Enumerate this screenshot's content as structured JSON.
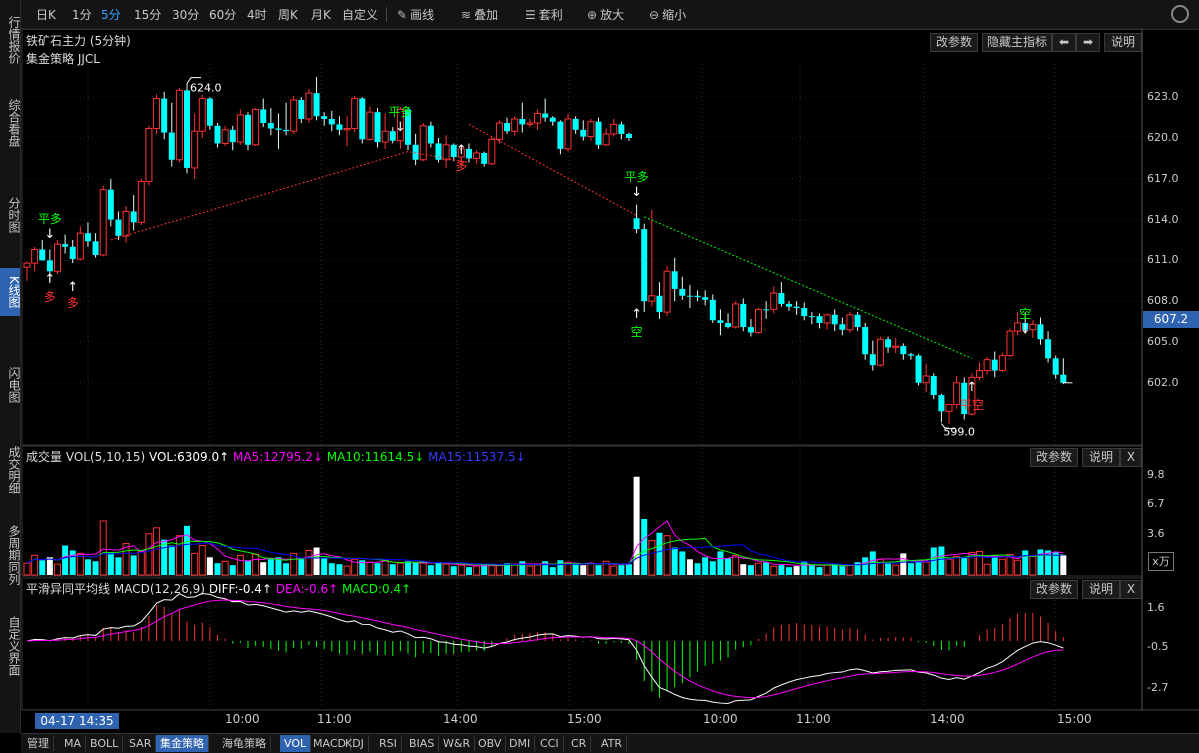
{
  "sidebar": {
    "items": [
      {
        "label": "行情报价",
        "active": false
      },
      {
        "label": "综合看盘",
        "active": false
      },
      {
        "label": "分时图",
        "active": false
      },
      {
        "label": "K线图",
        "active": true
      },
      {
        "label": "闪电图",
        "active": false
      },
      {
        "label": "成交明细",
        "active": false
      },
      {
        "label": "多周期同列",
        "active": false
      },
      {
        "label": "自定义界面",
        "active": false
      }
    ]
  },
  "toolbar": {
    "periods": [
      "日K",
      "1分",
      "5分",
      "15分",
      "30分",
      "60分",
      "4时",
      "周K",
      "月K",
      "自定义"
    ],
    "active_period": "5分",
    "tools": [
      {
        "label": "画线",
        "icon": "pencil-icon"
      },
      {
        "label": "叠加",
        "icon": "stack-icon"
      },
      {
        "label": "套利",
        "icon": "arbitrage-icon"
      },
      {
        "label": "放大",
        "icon": "zoom-in-icon"
      },
      {
        "label": "缩小",
        "icon": "zoom-out-icon"
      }
    ]
  },
  "main_panel": {
    "title": "铁矿石主力 (5分钟)",
    "strategy": "集金策略 JJCL",
    "buttons": {
      "params": "改参数",
      "hide": "隐藏主指标",
      "help": "说明"
    },
    "current_price": "607.2",
    "high_label": "624.0",
    "low_label": "599.0",
    "price_ticks": [
      "623.0",
      "620.0",
      "617.0",
      "614.0",
      "611.0",
      "608.0",
      "605.0",
      "602.0"
    ],
    "signals": [
      "平多",
      "多",
      "多",
      "平多",
      "多",
      "平多",
      "空",
      "空",
      "平空"
    ]
  },
  "volume_panel": {
    "name": "成交量",
    "formula": "VOL(5,10,15)",
    "vol": "VOL:6309.0↑",
    "ma5": "MA5:12795.2↓",
    "ma10": "MA10:11614.5↓",
    "ma15": "MA15:11537.5↓",
    "ticks": [
      "9.8",
      "6.7",
      "3.6"
    ],
    "unit": "x万",
    "buttons": {
      "params": "改参数",
      "help": "说明",
      "close": "X"
    }
  },
  "macd_panel": {
    "name": "平滑异同平均线",
    "formula": "MACD(12,26,9)",
    "diff": "DIFF:-0.4↑",
    "dea": "DEA:-0.6↑",
    "macd": "MACD:0.4↑",
    "ticks": [
      "1.6",
      "-0.5",
      "-2.7"
    ],
    "buttons": {
      "params": "改参数",
      "help": "说明",
      "close": "X"
    }
  },
  "x_axis": {
    "cursor_label": "04-17 14:35",
    "labels": [
      "10:00",
      "11:00",
      "14:00",
      "15:00",
      "10:00",
      "11:00",
      "14:00",
      "15:00"
    ]
  },
  "bottom_tabs": [
    "管理",
    "MA",
    "BOLL",
    "SAR",
    "集金策略",
    "海龟策略",
    "VOL",
    "MACD",
    "KDJ",
    "RSI",
    "BIAS",
    "W&R",
    "OBV",
    "DMI",
    "CCI",
    "CR",
    "ATR"
  ],
  "bottom_active": [
    "集金策略",
    "VOL"
  ],
  "colors": {
    "up": "#ff3232",
    "down": "#00ffff",
    "ma5": "#ff00ff",
    "ma10": "#00ff00",
    "ma15": "#0000ff",
    "diff": "#ffffff",
    "dea": "#ff00ff",
    "accent": "#2f63b0"
  },
  "chart_data": {
    "type": "candlestick",
    "price_range": [
      597.5,
      625.0
    ],
    "candles": [
      [
        610.5,
        610.9,
        609.5,
        610.8
      ],
      [
        610.8,
        612.0,
        610.2,
        611.8
      ],
      [
        611.8,
        612.5,
        611.0,
        611.0
      ],
      [
        611.0,
        611.8,
        609.5,
        610.2
      ],
      [
        610.2,
        612.5,
        610.0,
        612.2
      ],
      [
        612.2,
        612.9,
        611.5,
        612.0
      ],
      [
        612.0,
        612.5,
        610.8,
        611.1
      ],
      [
        611.1,
        613.5,
        611.0,
        613.0
      ],
      [
        613.0,
        613.8,
        612.0,
        612.4
      ],
      [
        612.4,
        613.0,
        611.2,
        611.4
      ],
      [
        611.4,
        616.5,
        611.3,
        616.2
      ],
      [
        616.2,
        617.0,
        613.5,
        614.0
      ],
      [
        614.0,
        614.6,
        612.5,
        612.8
      ],
      [
        612.8,
        615.0,
        612.3,
        614.6
      ],
      [
        614.6,
        615.8,
        613.2,
        613.8
      ],
      [
        613.8,
        617.0,
        613.6,
        616.8
      ],
      [
        616.8,
        620.9,
        616.5,
        620.7
      ],
      [
        620.7,
        623.2,
        620.3,
        622.9
      ],
      [
        622.9,
        623.4,
        619.9,
        620.4
      ],
      [
        620.4,
        622.6,
        617.9,
        618.4
      ],
      [
        618.4,
        623.7,
        618.2,
        623.5
      ],
      [
        623.5,
        624.0,
        617.4,
        617.8
      ],
      [
        617.8,
        621.8,
        617.0,
        620.5
      ],
      [
        620.5,
        623.2,
        620.0,
        622.9
      ],
      [
        622.9,
        623.0,
        620.6,
        620.9
      ],
      [
        620.9,
        621.1,
        619.3,
        619.6
      ],
      [
        619.6,
        620.9,
        619.4,
        620.6
      ],
      [
        620.6,
        620.9,
        619.1,
        619.7
      ],
      [
        619.7,
        622.1,
        619.5,
        621.7
      ],
      [
        621.7,
        621.9,
        619.1,
        619.5
      ],
      [
        619.5,
        622.2,
        619.4,
        622.1
      ],
      [
        622.1,
        622.9,
        620.8,
        621.1
      ],
      [
        621.1,
        622.2,
        620.2,
        620.7
      ],
      [
        620.7,
        621.8,
        619.2,
        620.6
      ],
      [
        620.6,
        622.6,
        620.2,
        620.5
      ],
      [
        620.5,
        623.1,
        620.3,
        622.8
      ],
      [
        622.8,
        623.0,
        621.1,
        621.4
      ],
      [
        621.4,
        623.6,
        621.1,
        623.3
      ],
      [
        623.3,
        624.5,
        621.3,
        621.6
      ],
      [
        621.6,
        621.9,
        620.9,
        621.4
      ],
      [
        621.4,
        622.0,
        620.5,
        621.0
      ],
      [
        621.0,
        621.6,
        620.2,
        620.6
      ],
      [
        620.6,
        621.6,
        619.4,
        620.7
      ],
      [
        620.7,
        623.1,
        620.4,
        622.9
      ],
      [
        622.9,
        623.0,
        619.6,
        619.9
      ],
      [
        619.9,
        622.3,
        619.8,
        621.9
      ],
      [
        621.9,
        622.2,
        619.3,
        619.7
      ],
      [
        619.7,
        621.8,
        619.2,
        620.5
      ],
      [
        620.5,
        620.8,
        619.6,
        619.8
      ],
      [
        619.8,
        622.3,
        619.2,
        622.1
      ],
      [
        622.1,
        622.2,
        619.1,
        619.5
      ],
      [
        619.5,
        620.3,
        618.0,
        618.4
      ],
      [
        618.4,
        621.1,
        618.3,
        620.9
      ],
      [
        620.9,
        621.2,
        619.3,
        619.6
      ],
      [
        619.6,
        620.0,
        618.2,
        618.4
      ],
      [
        618.4,
        620.2,
        617.8,
        619.5
      ],
      [
        619.5,
        619.6,
        618.3,
        618.6
      ],
      [
        618.6,
        619.5,
        618.0,
        619.2
      ],
      [
        619.2,
        619.6,
        618.2,
        618.5
      ],
      [
        618.5,
        619.1,
        618.1,
        618.9
      ],
      [
        618.9,
        619.0,
        617.9,
        618.1
      ],
      [
        618.1,
        620.1,
        618.0,
        619.9
      ],
      [
        619.9,
        621.3,
        619.6,
        621.1
      ],
      [
        621.1,
        621.5,
        620.3,
        620.5
      ],
      [
        620.5,
        621.6,
        620.2,
        621.4
      ],
      [
        621.4,
        622.6,
        620.4,
        621.0
      ],
      [
        621.0,
        621.4,
        620.8,
        621.1
      ],
      [
        621.1,
        622.1,
        620.6,
        621.8
      ],
      [
        621.8,
        622.9,
        621.2,
        621.5
      ],
      [
        621.5,
        621.6,
        620.9,
        621.2
      ],
      [
        621.2,
        621.3,
        618.8,
        619.2
      ],
      [
        619.2,
        621.8,
        619.0,
        621.4
      ],
      [
        621.4,
        621.6,
        620.3,
        620.6
      ],
      [
        620.6,
        621.3,
        619.8,
        620.1
      ],
      [
        620.1,
        621.4,
        619.8,
        621.2
      ],
      [
        621.2,
        621.5,
        619.2,
        619.5
      ],
      [
        619.5,
        620.7,
        619.4,
        620.3
      ],
      [
        620.3,
        621.4,
        620.1,
        621.0
      ],
      [
        621.0,
        621.2,
        619.9,
        620.3
      ],
      [
        620.3,
        620.4,
        619.8,
        620.0
      ],
      [
        614.1,
        615.1,
        613.0,
        613.3
      ],
      [
        613.3,
        613.7,
        607.2,
        608.0
      ],
      [
        608.0,
        614.7,
        607.6,
        608.4
      ],
      [
        608.4,
        609.4,
        606.7,
        607.2
      ],
      [
        607.2,
        610.6,
        606.9,
        610.2
      ],
      [
        610.2,
        611.2,
        608.0,
        608.9
      ],
      [
        608.9,
        609.8,
        608.1,
        608.4
      ],
      [
        608.4,
        609.2,
        607.5,
        608.4
      ],
      [
        608.4,
        608.8,
        608.0,
        608.3
      ],
      [
        608.3,
        608.8,
        607.7,
        608.1
      ],
      [
        608.1,
        608.5,
        606.4,
        606.6
      ],
      [
        606.6,
        607.4,
        605.5,
        606.4
      ],
      [
        606.4,
        607.1,
        606.0,
        606.1
      ],
      [
        606.1,
        608.0,
        606.0,
        607.8
      ],
      [
        607.8,
        608.2,
        605.8,
        606.1
      ],
      [
        606.1,
        606.7,
        605.4,
        605.7
      ],
      [
        605.7,
        607.5,
        605.6,
        607.4
      ],
      [
        607.4,
        608.0,
        606.7,
        607.4
      ],
      [
        607.4,
        609.1,
        607.1,
        608.6
      ],
      [
        608.6,
        609.4,
        607.6,
        607.8
      ],
      [
        607.8,
        608.0,
        607.3,
        607.6
      ],
      [
        607.6,
        608.0,
        607.0,
        607.5
      ],
      [
        607.5,
        607.9,
        606.6,
        606.9
      ],
      [
        606.9,
        607.2,
        606.3,
        606.9
      ],
      [
        606.9,
        607.1,
        606.0,
        606.4
      ],
      [
        606.4,
        607.1,
        605.9,
        607.0
      ],
      [
        607.0,
        607.4,
        605.8,
        606.3
      ],
      [
        606.3,
        606.8,
        605.5,
        605.9
      ],
      [
        605.9,
        607.2,
        605.7,
        607.0
      ],
      [
        607.0,
        607.2,
        605.8,
        606.1
      ],
      [
        606.1,
        606.4,
        603.7,
        604.1
      ],
      [
        604.1,
        605.1,
        602.9,
        603.3
      ],
      [
        603.3,
        605.4,
        603.2,
        605.2
      ],
      [
        605.2,
        605.4,
        604.2,
        604.6
      ],
      [
        604.6,
        605.3,
        604.2,
        604.7
      ],
      [
        604.7,
        604.9,
        603.7,
        604.1
      ],
      [
        604.1,
        604.2,
        603.7,
        604.0
      ],
      [
        604.0,
        604.1,
        601.8,
        602.0
      ],
      [
        602.0,
        603.4,
        601.3,
        602.5
      ],
      [
        602.5,
        602.7,
        600.8,
        601.1
      ],
      [
        601.1,
        601.2,
        599.1,
        599.9
      ],
      [
        599.9,
        600.4,
        599.0,
        600.4
      ],
      [
        600.4,
        602.5,
        600.1,
        602.0
      ],
      [
        602.0,
        602.4,
        599.3,
        599.7
      ],
      [
        599.7,
        602.7,
        599.6,
        602.4
      ],
      [
        602.4,
        603.5,
        602.2,
        602.9
      ],
      [
        602.9,
        603.9,
        602.6,
        603.7
      ],
      [
        603.7,
        604.3,
        602.4,
        602.9
      ],
      [
        602.9,
        604.2,
        602.8,
        604.0
      ],
      [
        604.0,
        606.0,
        603.9,
        605.8
      ],
      [
        605.8,
        607.2,
        605.5,
        606.4
      ],
      [
        606.4,
        607.2,
        605.6,
        605.9
      ],
      [
        605.9,
        606.6,
        605.3,
        606.3
      ],
      [
        606.3,
        606.8,
        604.8,
        605.2
      ],
      [
        605.2,
        605.8,
        603.5,
        603.8
      ],
      [
        603.8,
        604.0,
        602.3,
        602.6
      ],
      [
        602.6,
        603.8,
        601.9,
        602.0
      ]
    ]
  }
}
